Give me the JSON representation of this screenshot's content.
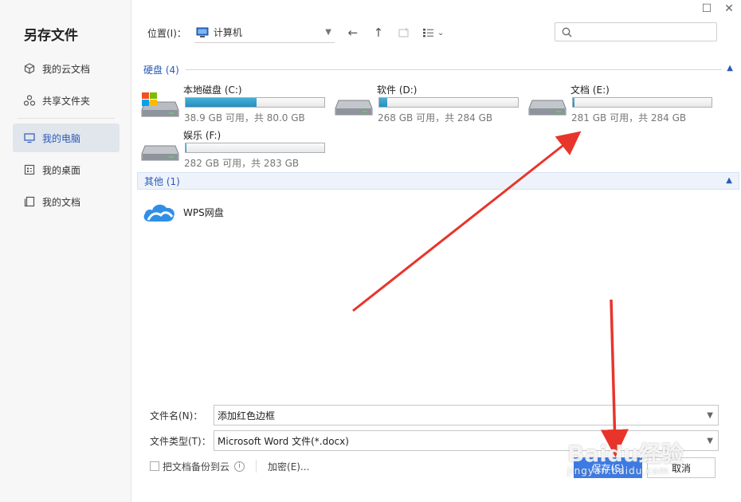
{
  "dialog": {
    "title": "另存文件"
  },
  "window_controls": {
    "maximize": "☐",
    "close": "✕"
  },
  "sidebar": {
    "items": [
      {
        "label": "我的云文档",
        "icon": "cloud-doc-icon"
      },
      {
        "label": "共享文件夹",
        "icon": "share-folder-icon"
      },
      {
        "label": "我的电脑",
        "icon": "monitor-icon",
        "active": true
      },
      {
        "label": "我的桌面",
        "icon": "desktop-icon"
      },
      {
        "label": "我的文档",
        "icon": "documents-icon"
      }
    ]
  },
  "toolbar": {
    "location_label": "位置(I)：",
    "location_value": "计算机",
    "search_placeholder": ""
  },
  "groups": {
    "disks": {
      "label": "硬盘 (4)"
    },
    "other": {
      "label": "其他 (1)"
    }
  },
  "drives": [
    {
      "name": "本地磁盘 (C:)",
      "info": "38.9 GB 可用，共 80.0 GB",
      "used_fraction": 0.51
    },
    {
      "name": "软件 (D:)",
      "info": "268 GB 可用，共 284 GB",
      "used_fraction": 0.06
    },
    {
      "name": "文档 (E:)",
      "info": "281 GB 可用，共 284 GB",
      "used_fraction": 0.01
    },
    {
      "name": "娱乐 (F:)",
      "info": "282 GB 可用，共 283 GB",
      "used_fraction": 0.004
    }
  ],
  "other_items": [
    {
      "name": "WPS网盘"
    }
  ],
  "form": {
    "filename_label": "文件名(N)：",
    "filename_value": "添加红色边框",
    "filetype_label": "文件类型(T)：",
    "filetype_value": "Microsoft Word 文件(*.docx)",
    "backup_label": "把文档备份到云",
    "encrypt_label": "加密(E)...",
    "save_label": "保存(S)",
    "cancel_label": "取消"
  },
  "watermark": {
    "brand": "Baidu经验",
    "url": "jingyan.baidu.com"
  },
  "colors": {
    "accent": "#3c7be6",
    "group_text": "#2a5ab8",
    "annotation_arrow": "#e8352b"
  }
}
